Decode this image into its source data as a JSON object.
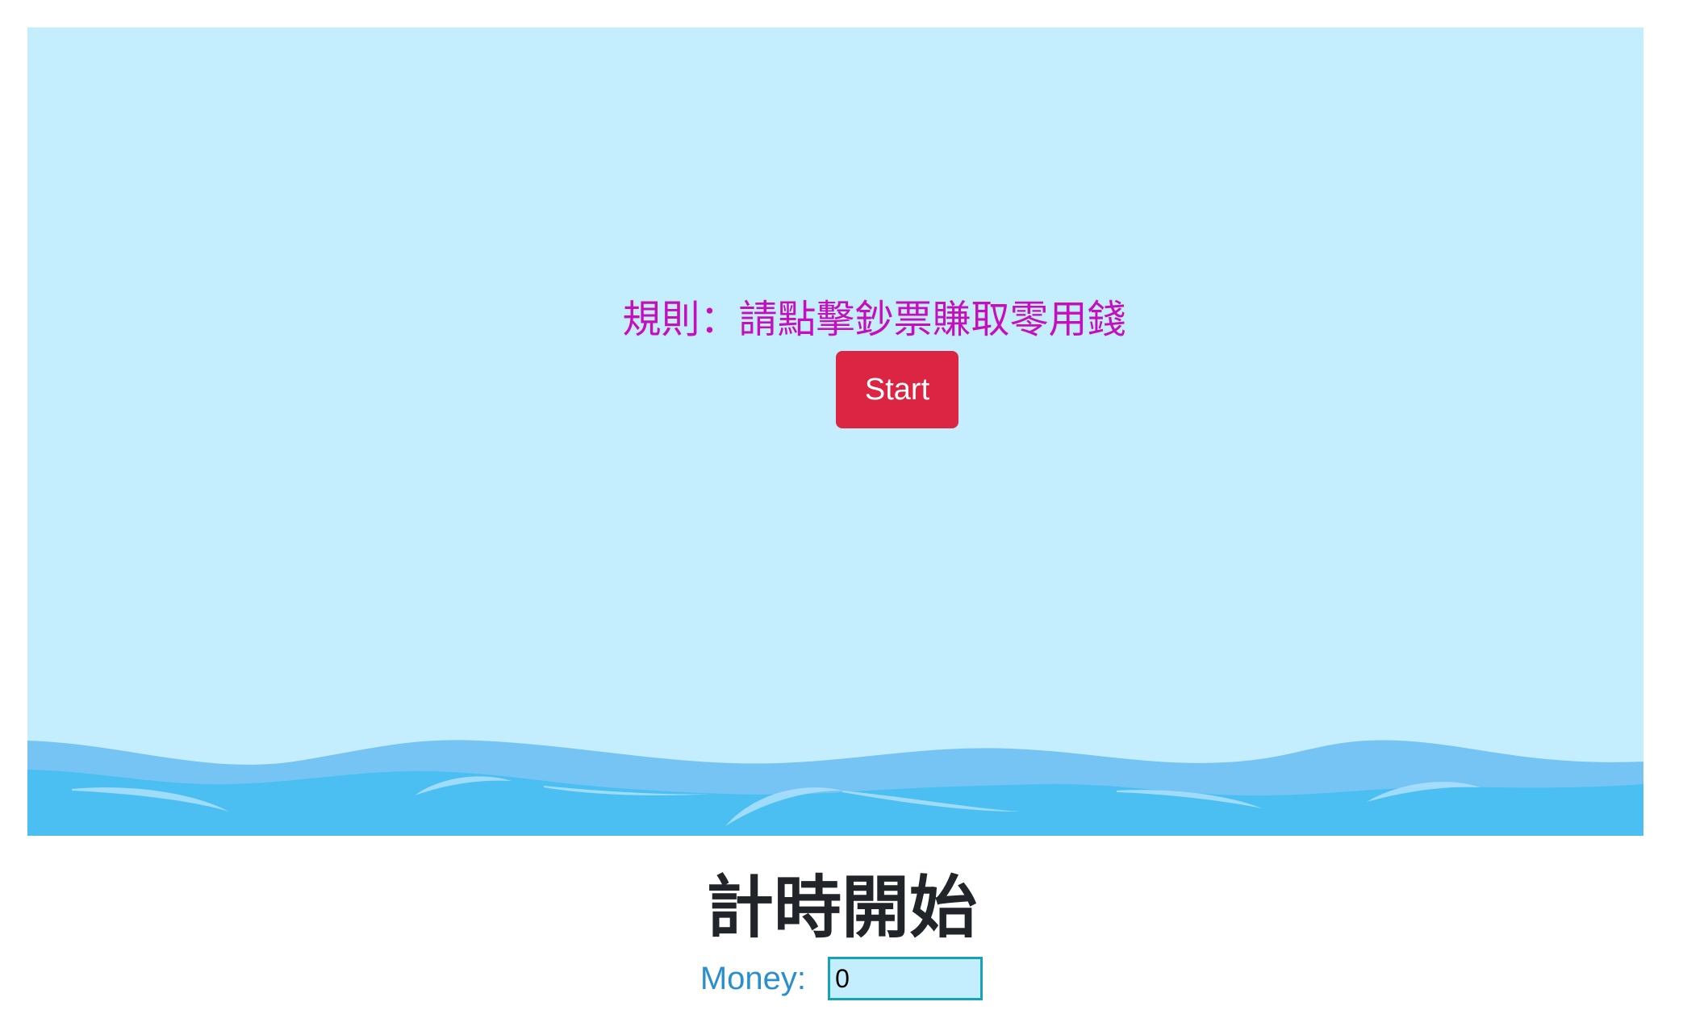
{
  "game": {
    "rules_text": "規則：請點擊鈔票賺取零用錢",
    "start_label": "Start"
  },
  "status": {
    "timer_title": "計時開始",
    "money_label": "Money:",
    "money_value": "0"
  },
  "colors": {
    "sky": "#c4eefe",
    "rules_text": "#c40fbd",
    "start_button": "#dc2543",
    "wave_light": "#76c4f3",
    "wave_dark": "#4bbff2",
    "money_label": "#2b8fce",
    "input_border": "#17a2b8"
  }
}
